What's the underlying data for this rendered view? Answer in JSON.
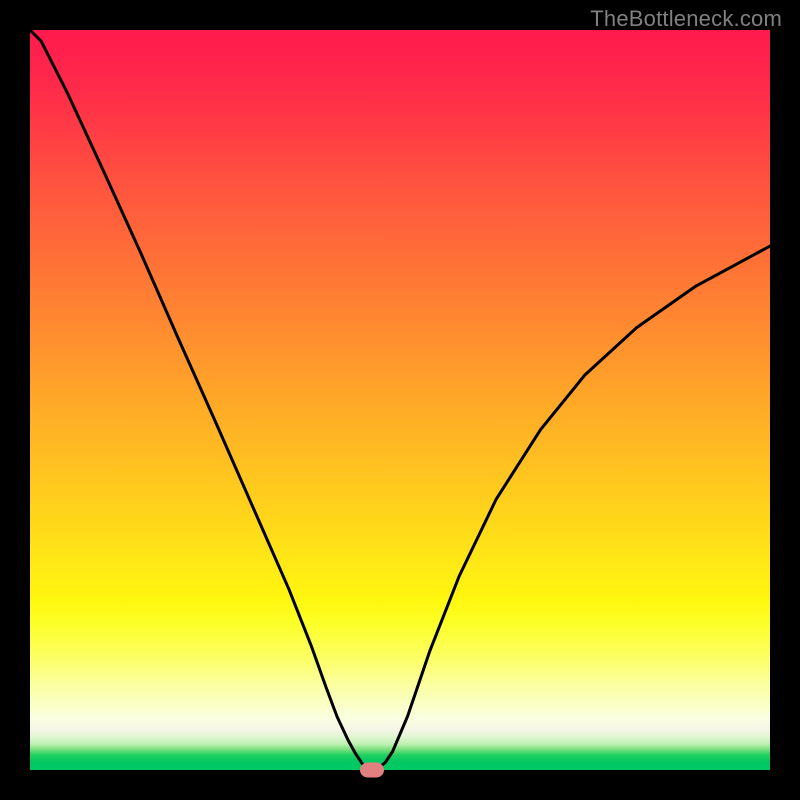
{
  "watermark": "TheBottleneck.com",
  "chart_data": {
    "type": "line",
    "title": "",
    "xlabel": "",
    "ylabel": "",
    "xlim": [
      0,
      1
    ],
    "ylim": [
      0,
      1
    ],
    "grid": false,
    "legend": false,
    "background_gradient": {
      "top": "#ff1a4d",
      "bottom": "#00c863",
      "description": "Vertical rainbow gradient red → orange → yellow → pale → green"
    },
    "series": [
      {
        "name": "bottleneck-curve",
        "x": [
          0.0,
          0.015,
          0.05,
          0.1,
          0.15,
          0.2,
          0.25,
          0.3,
          0.35,
          0.38,
          0.4,
          0.415,
          0.43,
          0.44,
          0.448,
          0.455,
          0.462,
          0.47,
          0.48,
          0.49,
          0.51,
          0.54,
          0.58,
          0.63,
          0.69,
          0.75,
          0.82,
          0.9,
          1.0
        ],
        "y": [
          1.0,
          0.985,
          0.916,
          0.808,
          0.698,
          0.584,
          0.472,
          0.358,
          0.244,
          0.168,
          0.112,
          0.072,
          0.04,
          0.022,
          0.01,
          0.002,
          0.0,
          0.002,
          0.01,
          0.025,
          0.072,
          0.16,
          0.262,
          0.366,
          0.46,
          0.534,
          0.598,
          0.654,
          0.708
        ]
      }
    ],
    "marker": {
      "x": 0.462,
      "y": 0.0,
      "color": "#e28080",
      "shape": "rounded-rect"
    }
  },
  "layout": {
    "canvas_size": 800,
    "border_px": 30,
    "plot_size": 740
  }
}
